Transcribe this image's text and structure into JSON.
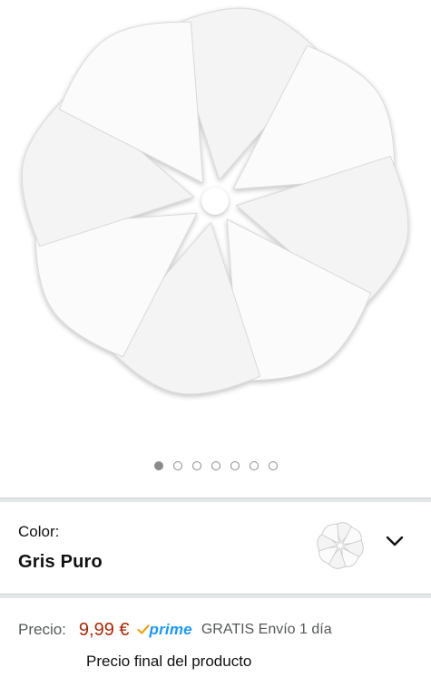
{
  "carousel": {
    "dot_count": 7,
    "active_index": 0
  },
  "variation": {
    "label": "Color:",
    "value": "Gris Puro"
  },
  "price": {
    "label": "Precio:",
    "amount": "9,99 €",
    "prime_label": "prime",
    "shipping_text": "GRATIS Envío 1 día",
    "final_note": "Precio final del producto"
  },
  "colors": {
    "price": "#b12704",
    "prime": "#1a98ff",
    "divider": "#e3e6e6"
  }
}
